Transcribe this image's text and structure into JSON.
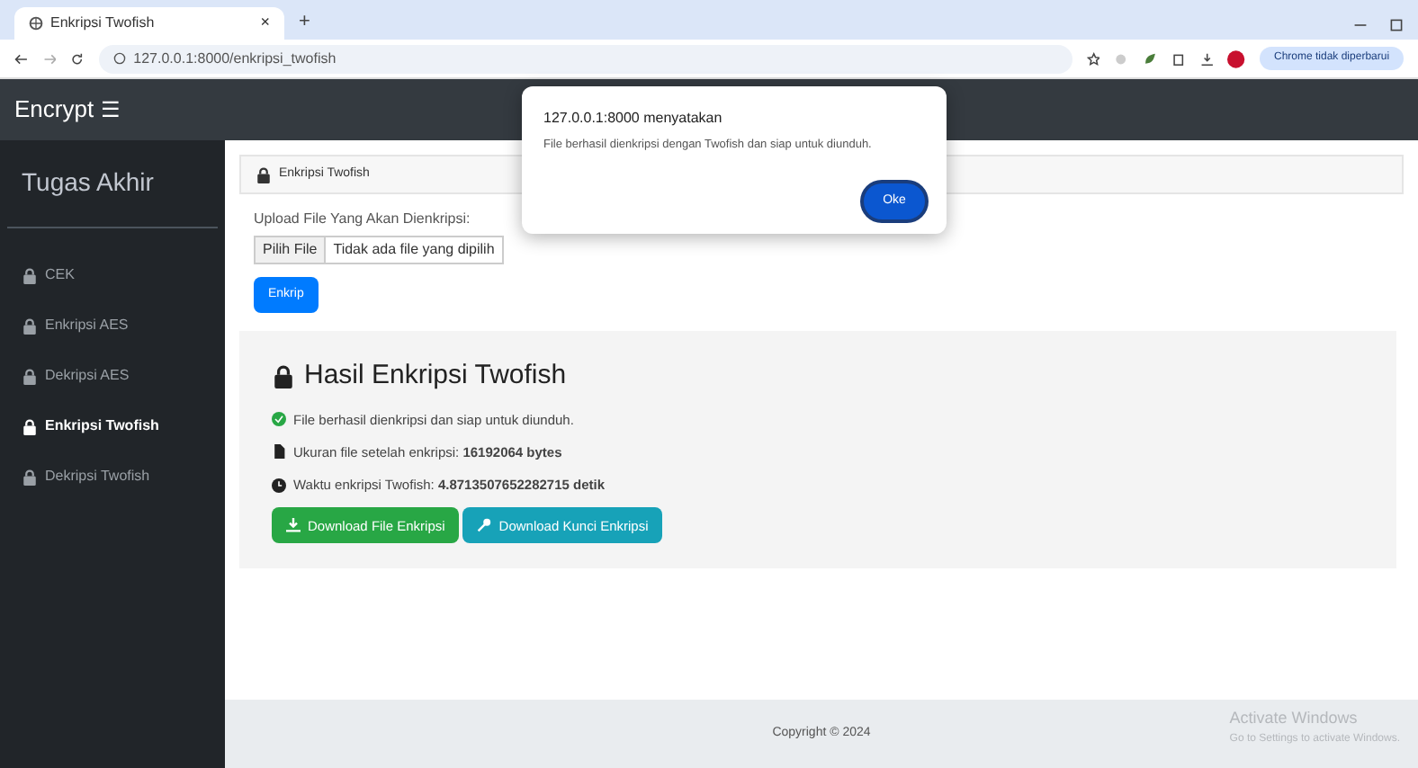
{
  "browser": {
    "tab_title": "Enkripsi Twofish",
    "tab_close": "×",
    "new_tab": "+",
    "url": "127.0.0.1:8000/enkripsi_twofish",
    "profile_chip": "Chrome tidak diperbarui"
  },
  "navbar": {
    "brand": "Encrypt",
    "menu_glyph": "☰"
  },
  "sidebar": {
    "title": "Tugas Akhir",
    "items": [
      {
        "label": "CEK",
        "selected": false
      },
      {
        "label": "Enkripsi AES",
        "selected": false
      },
      {
        "label": "Dekripsi AES",
        "selected": false
      },
      {
        "label": "Enkripsi Twofish",
        "selected": true
      },
      {
        "label": "Dekripsi Twofish",
        "selected": false
      }
    ]
  },
  "card": {
    "header": "Enkripsi Twofish",
    "upload_label": "Upload File Yang Akan Dienkripsi:",
    "file_button": "Pilih File",
    "file_placeholder": "Tidak ada file yang dipilih",
    "submit": "Enkrip"
  },
  "result": {
    "title": "Hasil Enkripsi Twofish",
    "lines": [
      {
        "kind": "success",
        "text": "File berhasil dienkripsi dan siap untuk diunduh."
      },
      {
        "kind": "file",
        "text": "Ukuran file setelah enkripsi: **16192064 bytes**"
      },
      {
        "kind": "clock",
        "text": "Waktu enkripsi Twofish: **4.8713507652282715 detik**"
      }
    ],
    "buttons": [
      {
        "kind": "download",
        "label": "Download File Enkripsi"
      },
      {
        "kind": "key",
        "label": "Download Kunci Enkripsi"
      }
    ]
  },
  "footer": {
    "text": "Copyright © 2024",
    "activation_title": "Activate Windows",
    "activation_note": "Go to Settings to activate Windows."
  },
  "dialog": {
    "origin": "127.0.0.1:8000 menyatakan",
    "message": "File berhasil dienkripsi dengan Twofish dan siap untuk diunduh.",
    "ok": "Oke"
  }
}
